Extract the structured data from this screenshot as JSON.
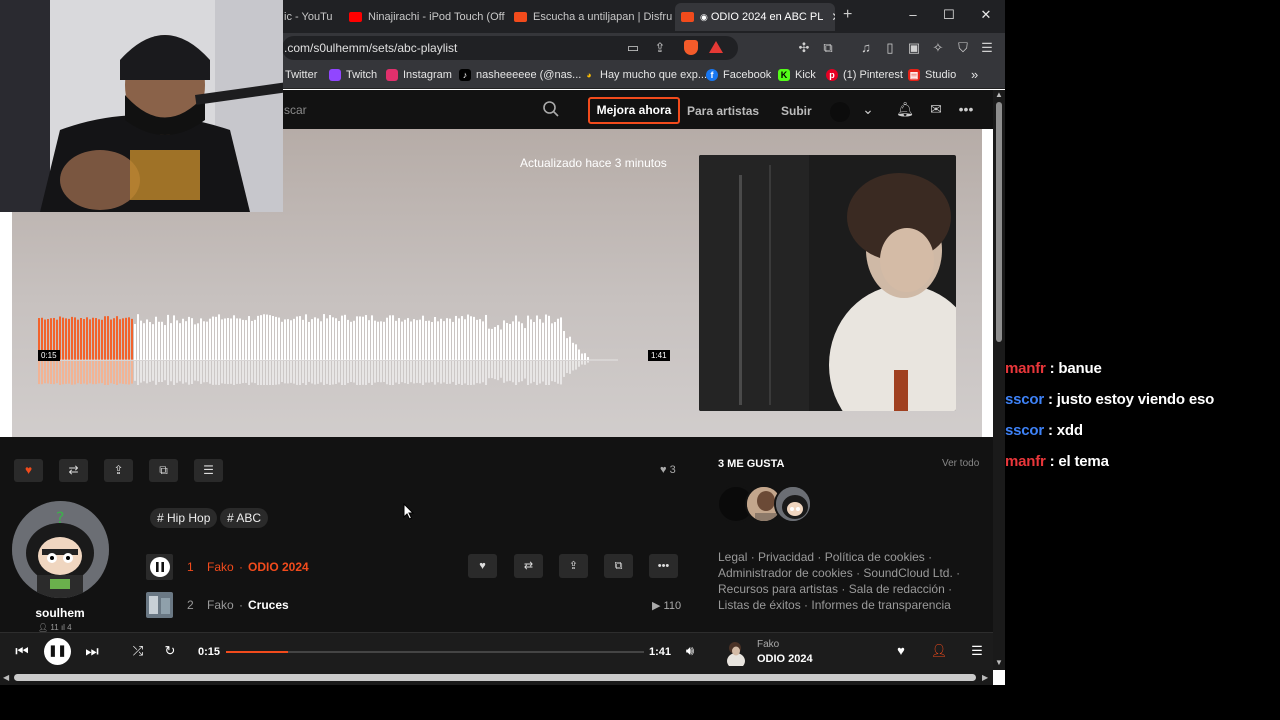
{
  "browser": {
    "tabs": [
      {
        "label": "ic - YouTu",
        "favicon_color": "#ff0000"
      },
      {
        "label": "Ninajirachi - iPod Touch (Offic",
        "favicon_color": "#ff0000"
      },
      {
        "label": "Escucha a untiljapan | Disfruta",
        "favicon_color": "#f24b1c"
      },
      {
        "label": "ODIO 2024 en ABC PL",
        "favicon_color": "#f24b1c",
        "active": true
      }
    ],
    "new_tab": "+",
    "window_controls": {
      "minimize": "–",
      "maximize": "☐",
      "close": "✕"
    },
    "url": ".com/s0ulhemm/sets/abc-playlist",
    "bookmarks": [
      {
        "label": "Twitter",
        "icon": "twitter-icon",
        "color": "#1d9bf0"
      },
      {
        "label": "Twitch",
        "icon": "twitch-icon",
        "color": "#9146ff"
      },
      {
        "label": "Instagram",
        "icon": "instagram-icon",
        "color": "#e1306c"
      },
      {
        "label": "nasheeeeee (@nas...",
        "icon": "tiktok-icon",
        "color": "#000000"
      },
      {
        "label": "Hay mucho que exp...",
        "icon": "google-icon",
        "color": "#fbbc05"
      },
      {
        "label": "Facebook",
        "icon": "facebook-icon",
        "color": "#1877f2"
      },
      {
        "label": "Kick",
        "icon": "kick-icon",
        "color": "#53fc18"
      },
      {
        "label": "(1) Pinterest",
        "icon": "pinterest-icon",
        "color": "#e60023"
      },
      {
        "label": "Studio",
        "icon": "studio-icon",
        "color": "#ff0000"
      }
    ],
    "more_bookmarks": "»"
  },
  "sc_header": {
    "search_placeholder": "scar",
    "upgrade_label": "Mejora ahora",
    "for_artists_label": "Para artistas",
    "upload_label": "Subir",
    "accent_color": "#f24b1c"
  },
  "hero": {
    "updated_text": "Actualizado hace 3 minutos",
    "current_time": "0:15",
    "total_time": "1:41",
    "progress_fraction": 0.148
  },
  "actions": {
    "like_count": "3"
  },
  "user": {
    "name": "soulhem",
    "followers": "11",
    "tracks": "4"
  },
  "tags": [
    "# Hip Hop",
    "# ABC"
  ],
  "tracks": [
    {
      "number": "1",
      "artist": "Fako",
      "title": "ODIO 2024",
      "active": true
    },
    {
      "number": "2",
      "artist": "Fako",
      "title": "Cruces",
      "plays": "110"
    }
  ],
  "sidebar": {
    "likes_heading": "3 ME GUSTA",
    "view_all": "Ver todo",
    "footer_links": [
      "Legal",
      "Privacidad",
      "Política de cookies",
      "Administrador de cookies",
      "SoundCloud Ltd.",
      "Recursos para artistas",
      "Sala de redacción",
      "Listas de éxitos",
      "Informes de transparencia"
    ]
  },
  "player": {
    "current_time": "0:15",
    "total_time": "1:41",
    "progress_fraction": 0.148,
    "artist": "Fako",
    "title": "ODIO 2024"
  },
  "chat": [
    {
      "user": "manfr",
      "message": " : banue",
      "color": "#e8363a"
    },
    {
      "user": "sscor",
      "message": " : justo estoy viendo eso",
      "color": "#3e82f7"
    },
    {
      "user": "sscor",
      "message": " : xdd",
      "color": "#3e82f7"
    },
    {
      "user": "manfr",
      "message": " : el tema",
      "color": "#e8363a"
    }
  ]
}
